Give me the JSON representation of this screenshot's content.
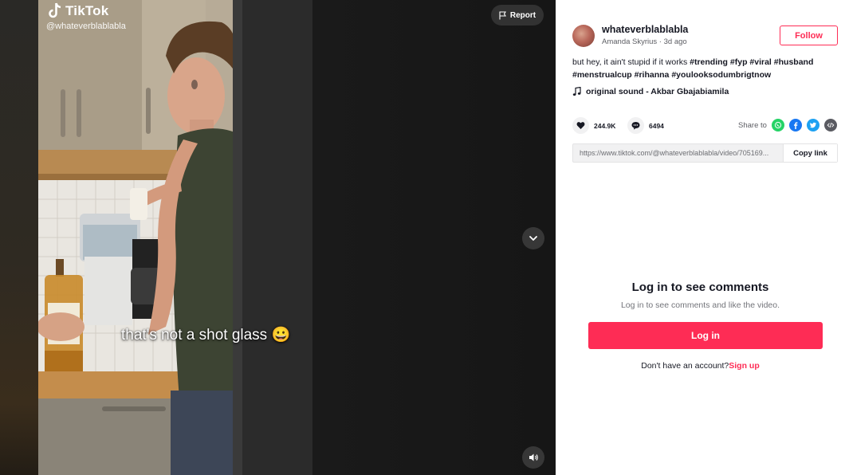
{
  "video": {
    "watermark_brand": "TikTok",
    "watermark_handle": "@whateverblablabla",
    "caption_text": "that's not a shot glass 😀",
    "report_label": "Report"
  },
  "author": {
    "username": "whateverblablabla",
    "display_name": "Amanda Skyrius",
    "separator": " · ",
    "posted_ago": "3d ago",
    "follow_label": "Follow"
  },
  "description": {
    "text": "but hey, it ain't stupid if it works ",
    "hashtags": [
      "#trending",
      "#fyp",
      "#viral",
      "#husband",
      "#menstrualcup",
      "#rihanna",
      "#youlooksodumbrigtnow"
    ]
  },
  "sound": {
    "label": "original sound - Akbar Gbajabiamila",
    "icon": "music-note-icon"
  },
  "stats": {
    "likes": "244.9K",
    "comments": "6494",
    "like_icon": "heart-icon",
    "comment_icon": "comment-icon"
  },
  "share": {
    "label": "Share to",
    "targets": [
      "whatsapp-icon",
      "facebook-icon",
      "twitter-icon",
      "embed-icon"
    ],
    "link_url": "https://www.tiktok.com/@whateverblablabla/video/705169...",
    "copy_label": "Copy link"
  },
  "comments_gate": {
    "title": "Log in to see comments",
    "subtitle": "Log in to see comments and like the video.",
    "login_label": "Log in",
    "signup_prompt": "Don't have an account?",
    "signup_label": "Sign up"
  },
  "colors": {
    "brand_red": "#fe2c55",
    "text_primary": "#161823",
    "text_secondary": "#5c5d63",
    "stage_bg": "#161616"
  }
}
